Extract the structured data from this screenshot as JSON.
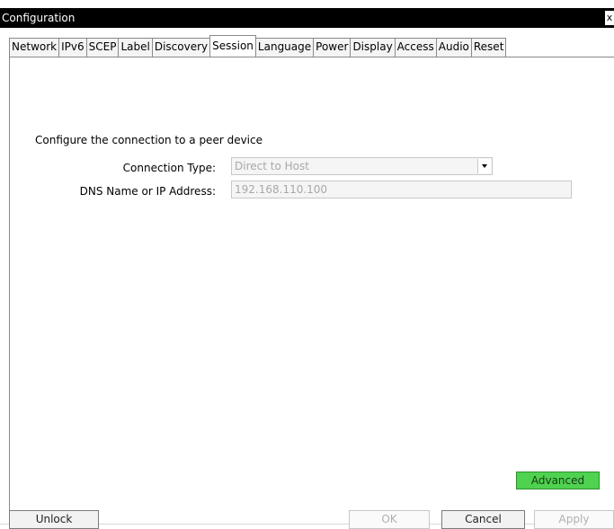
{
  "window": {
    "title": "Configuration",
    "close_label": "x"
  },
  "tabs": [
    {
      "label": "Network"
    },
    {
      "label": "IPv6"
    },
    {
      "label": "SCEP"
    },
    {
      "label": "Label"
    },
    {
      "label": "Discovery"
    },
    {
      "label": "Session"
    },
    {
      "label": "Language"
    },
    {
      "label": "Power"
    },
    {
      "label": "Display"
    },
    {
      "label": "Access"
    },
    {
      "label": "Audio"
    },
    {
      "label": "Reset"
    }
  ],
  "active_tab": "Session",
  "session": {
    "heading": "Configure the connection to a peer device",
    "connection_type_label": "Connection Type:",
    "connection_type_value": "Direct to Host",
    "dns_label": "DNS Name or IP Address:",
    "dns_value": "192.168.110.100"
  },
  "buttons": {
    "advanced": "Advanced",
    "unlock": "Unlock",
    "ok": "OK",
    "cancel": "Cancel",
    "apply": "Apply"
  },
  "colors": {
    "advanced_button": "#4fd24f",
    "titlebar": "#000000"
  }
}
